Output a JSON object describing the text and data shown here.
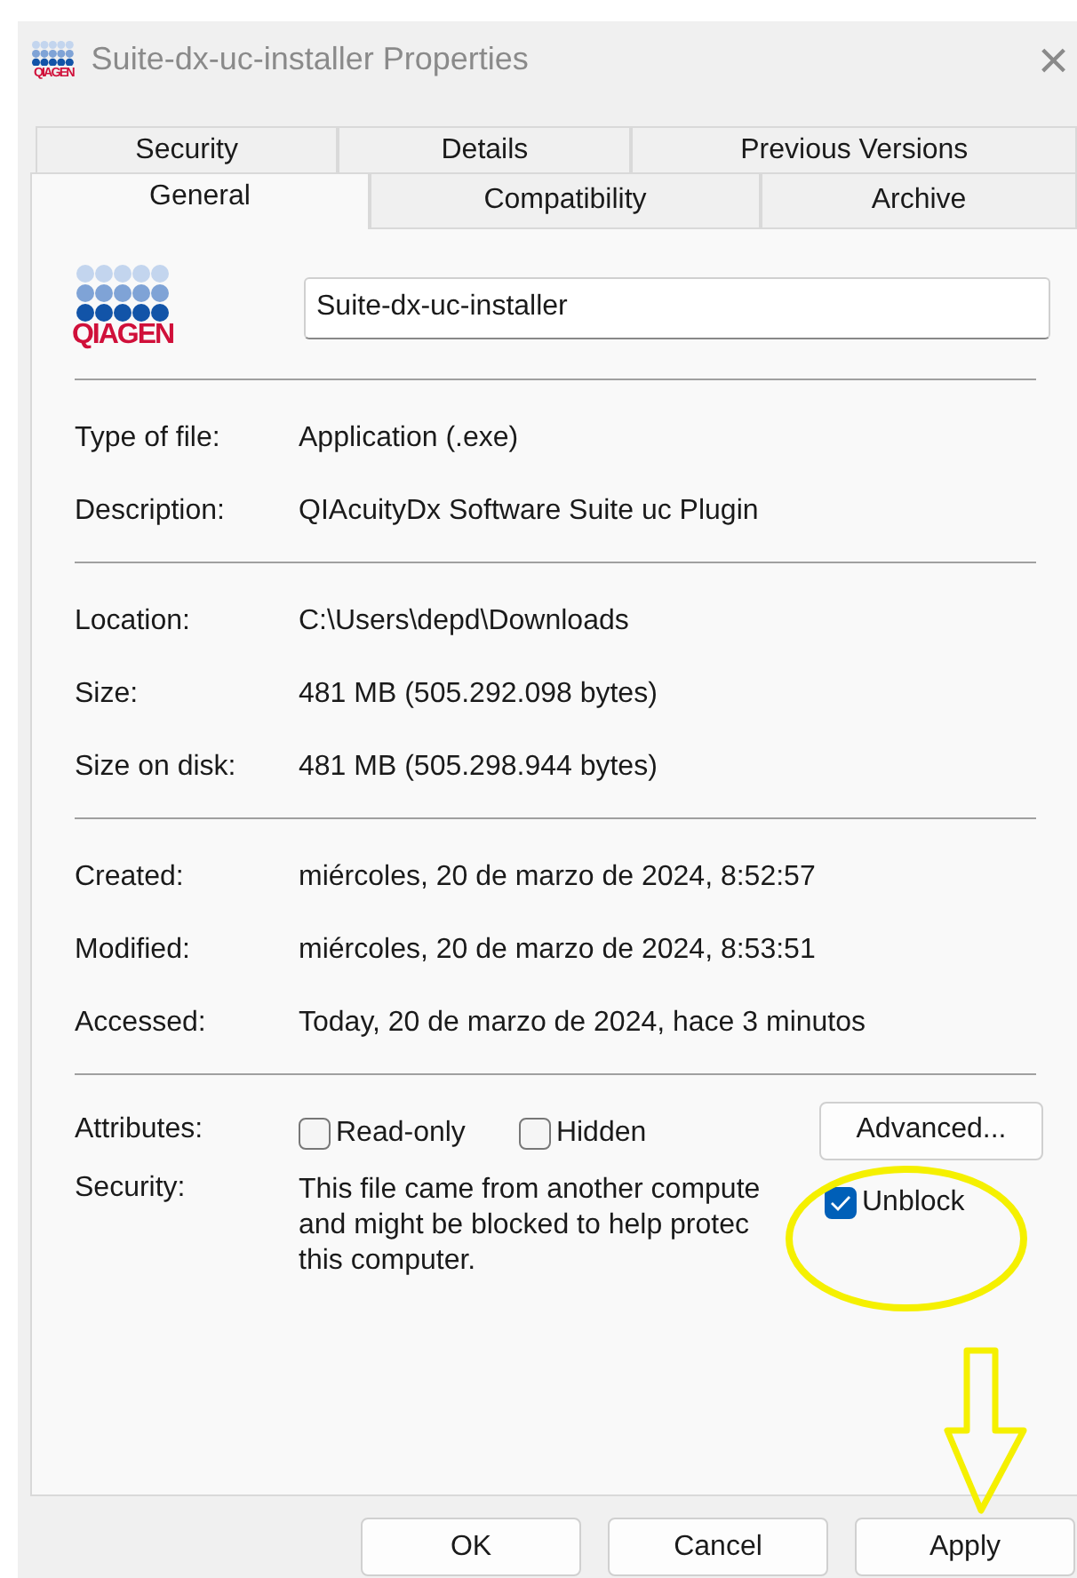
{
  "window": {
    "title": "Suite-dx-uc-installer Properties",
    "close": "×",
    "logo_text": "QIAGEN"
  },
  "tabs_back": [
    {
      "label": "Security",
      "selected": false
    },
    {
      "label": "Details",
      "selected": false
    },
    {
      "label": "Previous Versions",
      "selected": false
    }
  ],
  "tabs_front": [
    {
      "label": "General",
      "selected": true
    },
    {
      "label": "Compatibility",
      "selected": false
    },
    {
      "label": "Archive",
      "selected": false
    }
  ],
  "logo": {
    "text": "QIAGEN"
  },
  "name_field": {
    "value": "Suite-dx-uc-installer"
  },
  "groups": [
    [
      {
        "label": "Type of file:",
        "value": "Application (.exe)"
      },
      {
        "label": "Description:",
        "value": "QIAcuityDx Software Suite uc Plugin"
      }
    ],
    [
      {
        "label": "Location:",
        "value": "C:\\Users\\depd\\Downloads"
      },
      {
        "label": "Size:",
        "value": "481 MB (505.292.098 bytes)"
      },
      {
        "label": "Size on disk:",
        "value": "481 MB (505.298.944 bytes)"
      }
    ],
    [
      {
        "label": "Created:",
        "value": "miércoles, 20 de marzo de 2024, 8:52:57"
      },
      {
        "label": "Modified:",
        "value": "miércoles, 20 de marzo de 2024, 8:53:51"
      },
      {
        "label": "Accessed:",
        "value": "Today, 20 de marzo de 2024, hace 3 minutos"
      }
    ]
  ],
  "attributes": {
    "label": "Attributes:",
    "checkboxes": [
      {
        "label": "Read-only",
        "checked": false
      },
      {
        "label": "Hidden",
        "checked": false
      }
    ],
    "button": "Advanced..."
  },
  "security": {
    "label": "Security:",
    "lines": [
      "This file came from another compute",
      "and might be blocked to help protec",
      "this computer."
    ],
    "unblock": {
      "label": "Unblock",
      "checked": true
    }
  },
  "buttons": [
    "OK",
    "Cancel",
    "Apply"
  ]
}
